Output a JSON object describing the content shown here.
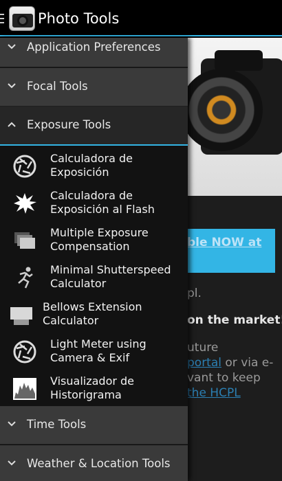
{
  "app": {
    "title": "Photo Tools",
    "accent_color": "#33b5e5"
  },
  "background": {
    "banner_text": "ble NOW at",
    "line1": "pl.",
    "line2": "on the market!",
    "line3": "uture",
    "line4_link": "portal",
    "line4_rest": " or via e-",
    "line5": "vant to keep",
    "line6_link": "the HCPL"
  },
  "drawer": {
    "groups_top": [
      {
        "label": "Application Preferences",
        "expanded": false
      },
      {
        "label": "Focal Tools",
        "expanded": false
      },
      {
        "label": "Exposure Tools",
        "expanded": true
      }
    ],
    "items": [
      {
        "line1": "Calculadora de",
        "line2": "Exposición",
        "icon": "aperture-icon"
      },
      {
        "line1": "Calculadora de",
        "line2": "Exposición al Flash",
        "icon": "flash-burst-icon"
      },
      {
        "line1": "Multiple Exposure",
        "line2": "Compensation",
        "icon": "stacked-frames-icon"
      },
      {
        "line1": "Minimal Shutterspeed",
        "line2": "Calculator",
        "icon": "running-person-icon"
      },
      {
        "line1": "Bellows Extension",
        "line2": "Calculator",
        "icon": "bellows-icon"
      },
      {
        "line1": "Light Meter using",
        "line2": "Camera & Exif",
        "icon": "aperture-icon"
      },
      {
        "line1": "Visualizador de",
        "line2": "Historigrama",
        "icon": "histogram-icon"
      }
    ],
    "groups_bottom": [
      {
        "label": "Time Tools",
        "expanded": false
      },
      {
        "label": "Weather & Location Tools",
        "expanded": false
      }
    ]
  }
}
